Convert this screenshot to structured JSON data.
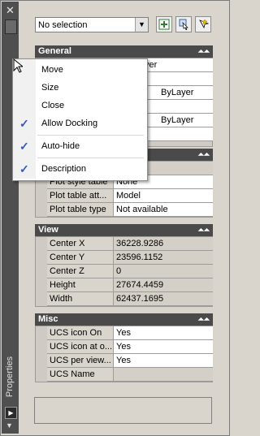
{
  "selection": {
    "value": "No selection"
  },
  "sidebar": {
    "title": "Properties"
  },
  "sections": {
    "general": {
      "title": "General",
      "visible_values": [
        "yer",
        "ByLayer",
        "ByLayer"
      ]
    },
    "plot": {
      "rows": [
        {
          "key": "Plot style table",
          "value": "None"
        },
        {
          "key": "Plot table att...",
          "value": "Model"
        },
        {
          "key": "Plot table type",
          "value": "Not available"
        }
      ]
    },
    "view": {
      "title": "View",
      "rows": [
        {
          "key": "Center X",
          "value": "36228.9286"
        },
        {
          "key": "Center Y",
          "value": "23596.1152"
        },
        {
          "key": "Center Z",
          "value": "0"
        },
        {
          "key": "Height",
          "value": "27674.4459"
        },
        {
          "key": "Width",
          "value": "62437.1695"
        }
      ]
    },
    "misc": {
      "title": "Misc",
      "rows": [
        {
          "key": "UCS icon On",
          "value": "Yes"
        },
        {
          "key": "UCS icon at o...",
          "value": "Yes"
        },
        {
          "key": "UCS per view...",
          "value": "Yes"
        },
        {
          "key": "UCS Name",
          "value": ""
        }
      ]
    }
  },
  "menu": {
    "items": [
      {
        "label": "Move",
        "checked": false
      },
      {
        "label": "Size",
        "checked": false
      },
      {
        "label": "Close",
        "checked": false
      },
      {
        "label": "Allow Docking",
        "checked": true
      },
      {
        "label": "Auto-hide",
        "checked": true
      },
      {
        "label": "Description",
        "checked": true
      }
    ]
  },
  "colors": {
    "section_header": "#4a4a4a",
    "check": "#3a58b8",
    "strip": "#4f4f4f"
  },
  "icons": [
    "close-icon",
    "dropdown-arrow-icon",
    "quick-select-icon",
    "select-objects-icon",
    "pickadd-toggle-icon",
    "collapse-icon",
    "checkmark-icon",
    "mouse-cursor-icon"
  ]
}
